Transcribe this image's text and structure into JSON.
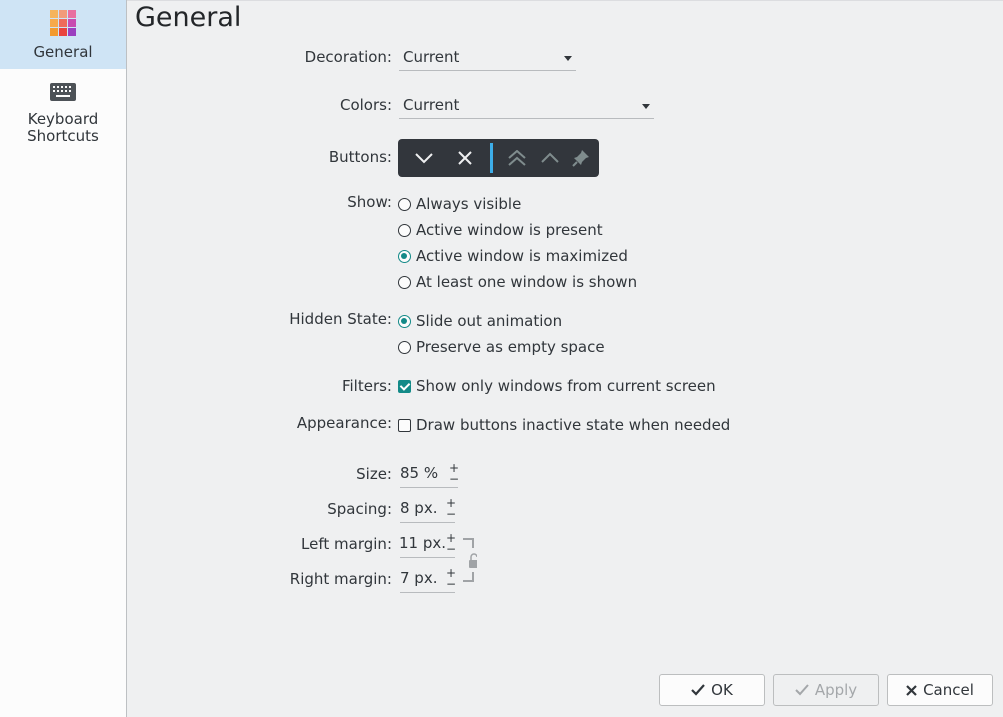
{
  "sidebar": {
    "items": [
      {
        "label": "General",
        "icon": "general-settings-icon"
      },
      {
        "label_line1": "Keyboard",
        "label_line2": "Shortcuts",
        "icon": "keyboard-icon"
      }
    ]
  },
  "page": {
    "title": "General"
  },
  "form": {
    "decoration_label": "Decoration:",
    "decoration_value": "Current",
    "colors_label": "Colors:",
    "colors_value": "Current",
    "buttons_label": "Buttons:",
    "show_label": "Show:",
    "show_options": [
      "Always visible",
      "Active window is present",
      "Active window is maximized",
      "At least one window is shown"
    ],
    "show_selected": "Active window is maximized",
    "hidden_label": "Hidden State:",
    "hidden_options": [
      "Slide out animation",
      "Preserve as empty space"
    ],
    "hidden_selected": "Slide out animation",
    "filters_label": "Filters:",
    "filters_option": "Show only windows from current screen",
    "filters_checked": true,
    "appearance_label": "Appearance:",
    "appearance_option": "Draw buttons inactive state when needed",
    "appearance_checked": false,
    "size_label": "Size:",
    "size_value": "85 %",
    "spacing_label": "Spacing:",
    "spacing_value": "8 px.",
    "left_margin_label": "Left margin:",
    "left_margin_value": "11 px.",
    "right_margin_label": "Right margin:",
    "right_margin_value": "7 px.",
    "plus": "+",
    "minus": "−"
  },
  "buttons_bar": {
    "icons": [
      "minimize-icon",
      "close-icon",
      "separator",
      "keep-above-icon",
      "maximize-icon",
      "pin-icon"
    ]
  },
  "dialog": {
    "ok_label": "OK",
    "apply_label": "Apply",
    "cancel_label": "Cancel"
  },
  "colors": {
    "accent": "#138a88",
    "sidebar_selected": "#cfe4f5",
    "buttonbar_bg": "#32363c",
    "separator_blue": "#3daee9"
  }
}
